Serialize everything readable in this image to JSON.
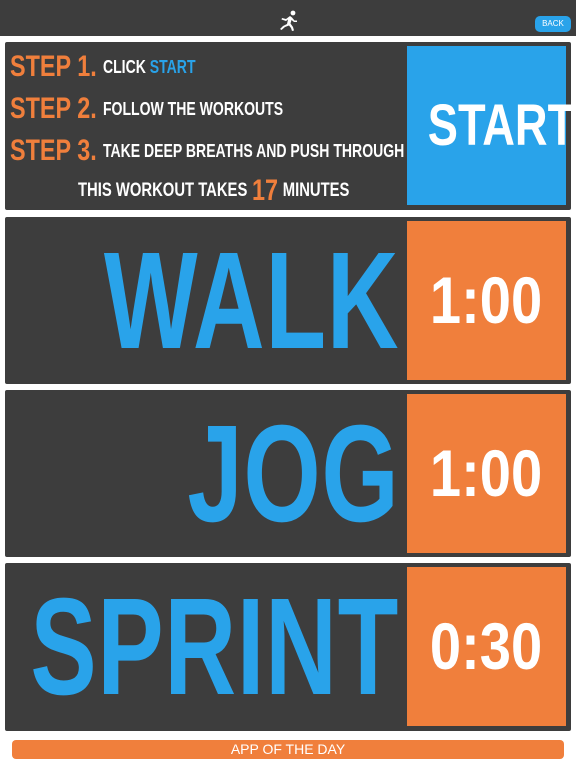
{
  "header": {
    "icon": "runner-icon",
    "back_label": "BACK"
  },
  "steps": {
    "step1_num": "STEP 1.",
    "step1_text_prefix": "CLICK",
    "step1_text_highlight": "START",
    "step2_num": "STEP 2.",
    "step2_text": "FOLLOW THE WORKOUTS",
    "step3_num": "STEP 3.",
    "step3_text": "TAKE DEEP BREATHS AND PUSH THROUGH",
    "duration_prefix": "THIS WORKOUT TAKES",
    "duration_value": "17",
    "duration_suffix": "MINUTES",
    "start_label": "START"
  },
  "workouts": [
    {
      "label": "WALK",
      "time": "1:00"
    },
    {
      "label": "JOG",
      "time": "1:00"
    },
    {
      "label": "SPRINT",
      "time": "0:30"
    }
  ],
  "footer": {
    "app_of_day_label": "APP OF THE DAY"
  },
  "colors": {
    "background_dark": "#3d3d3d",
    "accent_blue": "#29a3ea",
    "accent_orange": "#f07f3c",
    "text_white": "#ffffff"
  }
}
